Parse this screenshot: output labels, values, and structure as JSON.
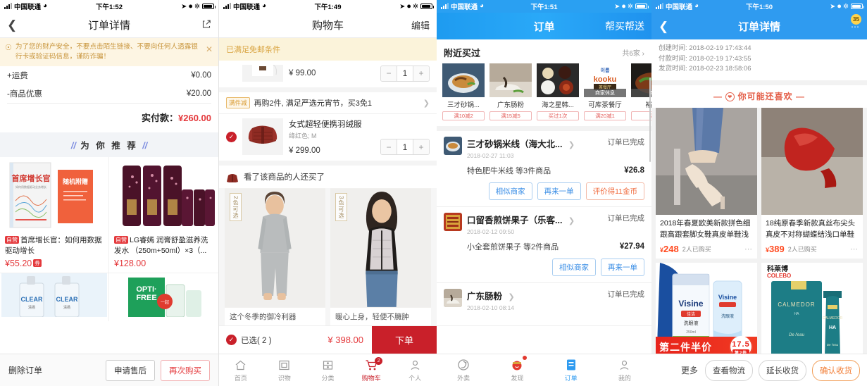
{
  "panel1": {
    "status": {
      "carrier": "中国联通",
      "time": "下午1:52"
    },
    "nav": {
      "title": "订单详情",
      "back_icon": "chevron-left-icon",
      "share_icon": "share-icon"
    },
    "warning": {
      "text": "为了您的财产安全，不要点击陌生链接、不要向任何人透露银行卡或验证码信息，谨防诈骗！",
      "bell_icon": "bell-icon",
      "close_icon": "close-icon"
    },
    "fees": [
      {
        "label": "+运费",
        "value": "¥0.00"
      },
      {
        "label": "-商品优惠",
        "value": "¥20.00"
      }
    ],
    "pay_label": "实付款：",
    "pay_value": "¥260.00",
    "rec_header": "为 你 推 荐",
    "products": [
      {
        "tag": "自营",
        "title": "首席增长官：如何用数据驱动增长",
        "price": "¥55.20",
        "coupon": "券",
        "image": "book-cover"
      },
      {
        "tag": "自营",
        "title": "LG睿嫣 润膏舒盈滋养洗发水 （250m+50ml）×3（...",
        "price": "¥128.00",
        "coupon": "",
        "image": "shampoo-tubes"
      },
      {
        "tag": "",
        "title": "",
        "price": "",
        "coupon": "",
        "image": "clear-shampoo"
      },
      {
        "tag": "",
        "title": "",
        "price": "",
        "coupon": "",
        "image": "opti-free"
      }
    ],
    "scroll_top_icon": "arrow-up-circle-icon",
    "bottom": {
      "delete": "删除订单",
      "aftersale": "申请售后",
      "rebuy": "再次购买"
    }
  },
  "panel2": {
    "status": {
      "carrier": "中国联通",
      "time": "下午1:49"
    },
    "nav": {
      "title": "购物车",
      "edit": "编辑"
    },
    "freeship": "已满足免邮条件",
    "partial_item": {
      "price": "¥ 99.00",
      "qty": "1"
    },
    "promo": {
      "tag": "满件减",
      "text": "再购2件, 满足严选元宵节，买3免1",
      "arrow": "chevron-right-icon"
    },
    "item": {
      "title": "女式超轻便携羽绒服",
      "spec": "绛红色; M",
      "price": "¥ 299.00",
      "qty": "1",
      "checked_icon": "check-circle-icon"
    },
    "also_bought": "看了该商品的人还买了",
    "cards": [
      {
        "ribbon": "2色可选",
        "caption": "这个冬季的御冷利器",
        "image": "thermal-underwear-model"
      },
      {
        "ribbon": "3色可选",
        "caption": "暖心上身，轻便不臃肿",
        "image": "down-vest-model"
      }
    ],
    "cartbar": {
      "selected": "已选( 2 )",
      "total": "¥ 398.00",
      "order": "下单"
    },
    "tabs": [
      {
        "label": "首页",
        "icon": "home-icon",
        "active": false,
        "badge": ""
      },
      {
        "label": "识物",
        "icon": "scan-icon",
        "active": false,
        "badge": ""
      },
      {
        "label": "分类",
        "icon": "category-icon",
        "active": false,
        "badge": ""
      },
      {
        "label": "购物车",
        "icon": "cart-icon",
        "active": true,
        "badge": "2"
      },
      {
        "label": "个人",
        "icon": "person-icon",
        "active": false,
        "badge": ""
      }
    ]
  },
  "panel3": {
    "status": {
      "carrier": "中国联通",
      "time": "下午1:51"
    },
    "nav": {
      "title": "订单",
      "right": "帮买帮送"
    },
    "nearby": {
      "title": "附近买过",
      "more": "共6家 ›"
    },
    "shops": [
      {
        "name": "三才砂锅...",
        "tag": "满10减2",
        "rest": "",
        "image": "claypot-dish"
      },
      {
        "name": "广东肠粉",
        "tag": "满15减5",
        "rest": "",
        "image": "rice-roll-dish"
      },
      {
        "name": "海之星韩...",
        "tag": "买过1次",
        "rest": "",
        "image": "korean-set"
      },
      {
        "name": "可库茶餐厅",
        "tag": "满20减1",
        "rest": "商家休息",
        "image": "kooku-logo"
      },
      {
        "name": "裕翔",
        "tag": "满",
        "rest": "商",
        "image": "stirfry-dish"
      }
    ],
    "orders": [
      {
        "name": "三才砂锅米线（海大北...",
        "status": "订单已完成",
        "time": "2018-02-27 11:03",
        "goods": "特色肥牛米线 等3件商品",
        "price": "¥26.8",
        "actions": [
          {
            "label": "相似商家",
            "style": "blue"
          },
          {
            "label": "再来一单",
            "style": "blue"
          },
          {
            "label": "评价得11金币",
            "style": "warm"
          }
        ],
        "image": "claypot-dish"
      },
      {
        "name": "口留香煎饼果子（乐客...",
        "status": "订单已完成",
        "time": "2018-02-12 09:50",
        "goods": "小全套煎饼果子 等2件商品",
        "price": "¥27.94",
        "actions": [
          {
            "label": "相似商家",
            "style": "blue"
          },
          {
            "label": "再来一单",
            "style": "blue"
          }
        ],
        "image": "pancake-shop-logo"
      },
      {
        "name": "广东肠粉",
        "status": "订单已完成",
        "time": "2018-02-10 08:14",
        "goods": "",
        "price": "",
        "actions": [],
        "image": "rice-roll-dish"
      }
    ],
    "tabs": [
      {
        "label": "外卖",
        "icon": "takeout-icon",
        "active": false,
        "badge": ""
      },
      {
        "label": "发现",
        "icon": "discover-icon",
        "active": false,
        "badge": "•"
      },
      {
        "label": "订单",
        "icon": "order-icon",
        "active": true,
        "badge": ""
      },
      {
        "label": "我的",
        "icon": "person-icon",
        "active": false,
        "badge": ""
      }
    ]
  },
  "panel4": {
    "status": {
      "carrier": "中国联通",
      "time": "下午1:50"
    },
    "nav": {
      "title": "订单详情",
      "back_icon": "chevron-left-icon",
      "more_icon": "more-dots-icon",
      "badge": "35"
    },
    "times": [
      {
        "label": "创建时间:",
        "value": "2018-02-19 17:43:44"
      },
      {
        "label": "付款时间:",
        "value": "2018-02-19 17:43:55"
      },
      {
        "label": "发货时间:",
        "value": "2018-02-23 18:58:06"
      }
    ],
    "like_header": "你可能还喜欢",
    "like_items": [
      {
        "title": "2018年春夏欧美新款拼色细跟高跟套脚女鞋真皮单鞋浅",
        "price": "¥248",
        "currency": "¥",
        "amount": "248",
        "sold": "2人已购买",
        "image": "nude-heels"
      },
      {
        "title": "18纯原春季新款真丝布尖头真皮不对称蝴蝶结浅口单鞋",
        "price": "¥389",
        "currency": "¥",
        "amount": "389",
        "sold": "2人已购买",
        "image": "red-flats"
      },
      {
        "title": "",
        "price": "",
        "sold": "",
        "image": "visine-eyedrops",
        "banner": "第二件半价",
        "banner_price": "17.5",
        "banner_note": "第2件"
      },
      {
        "title": "",
        "price": "",
        "sold": "",
        "image": "colebo-serum"
      }
    ],
    "bottom": {
      "more": "更多",
      "actions": [
        "查看物流",
        "延长收货",
        "确认收货"
      ]
    }
  }
}
